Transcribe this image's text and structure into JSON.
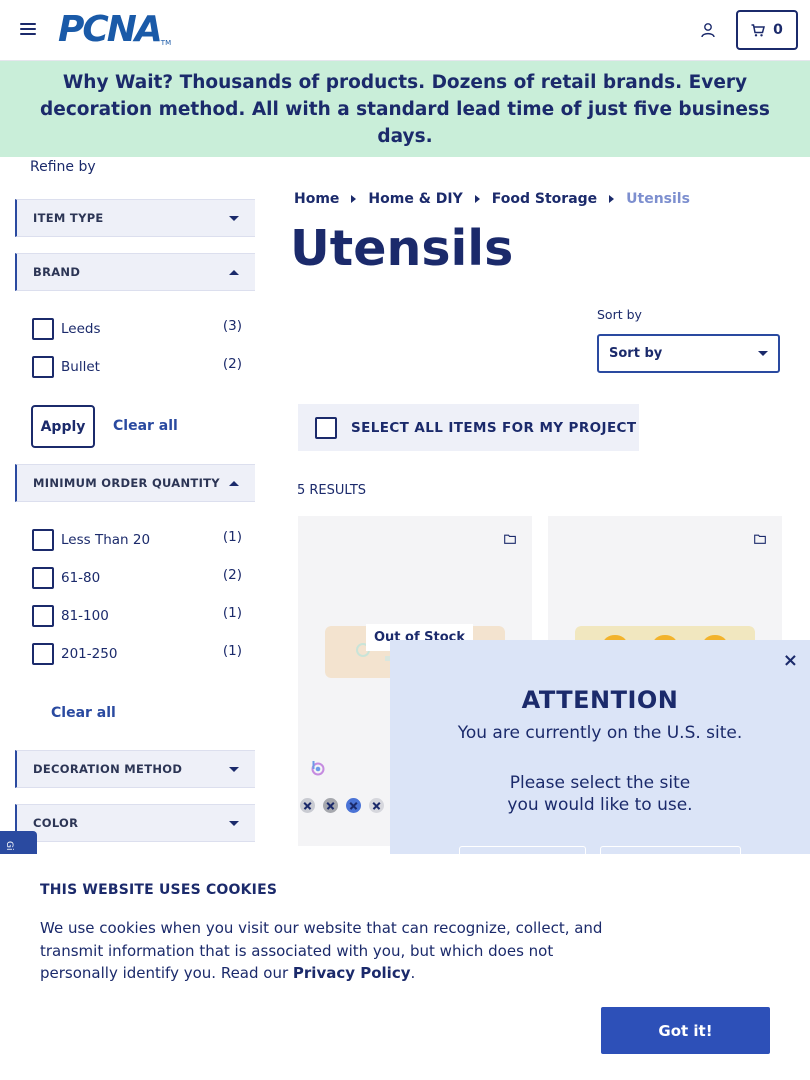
{
  "header": {
    "logo_text": "PCNA",
    "logo_tm": "TM",
    "cart_count": "0"
  },
  "banner": {
    "text": "Why Wait? Thousands of products. Dozens of retail brands. Every decoration method. All with a standard lead time of just five business days."
  },
  "sidebar": {
    "refine_label": "Refine by",
    "facets": {
      "item_type": "ITEM TYPE",
      "brand": "BRAND",
      "moq": "MINIMUM ORDER QUANTITY",
      "decoration": "DECORATION METHOD",
      "color": "COLOR"
    },
    "brand_options": [
      {
        "label": "Leeds",
        "count": "(3)"
      },
      {
        "label": "Bullet",
        "count": "(2)"
      }
    ],
    "moq_options": [
      {
        "label": "Less Than 20",
        "count": "(1)"
      },
      {
        "label": "61-80",
        "count": "(2)"
      },
      {
        "label": "81-100",
        "count": "(1)"
      },
      {
        "label": "201-250",
        "count": "(1)"
      }
    ],
    "apply_label": "Apply",
    "clear_all_label": "Clear all"
  },
  "breadcrumb": [
    "Home",
    "Home & DIY",
    "Food Storage",
    "Utensils"
  ],
  "page_title": "Utensils",
  "sort": {
    "label": "Sort by",
    "value": "Sort by"
  },
  "select_all_label": "SELECT ALL ITEMS FOR MY PROJECT",
  "results_label": "5 RESULTS",
  "products": [
    {
      "badge": "Out of Stock",
      "swatches": [
        "#c9cbd2",
        "#a6a8ae",
        "#4a73d6",
        "#d6d7dd"
      ]
    },
    {
      "badge": "",
      "swatches": []
    }
  ],
  "colors": {
    "brand_blue": "#1b2a6b",
    "accent_blue": "#2d50b8",
    "banner_bg": "#c9eed9",
    "modal_bg": "#dbe4f7"
  },
  "side_tab_text": "Gi",
  "modal": {
    "close": "×",
    "title": "ATTENTION",
    "subtitle": "You are currently on the U.S. site.",
    "prompt": "Please select the site you would like to use."
  },
  "cookie": {
    "title": "THIS WEBSITE USES COOKIES",
    "body": "We use cookies when you visit our website that can recognize, collect, and transmit information that is associated with you, but which does not personally identify you. Read our ",
    "link": "Privacy Policy",
    "end": ".",
    "button": "Got it!"
  }
}
